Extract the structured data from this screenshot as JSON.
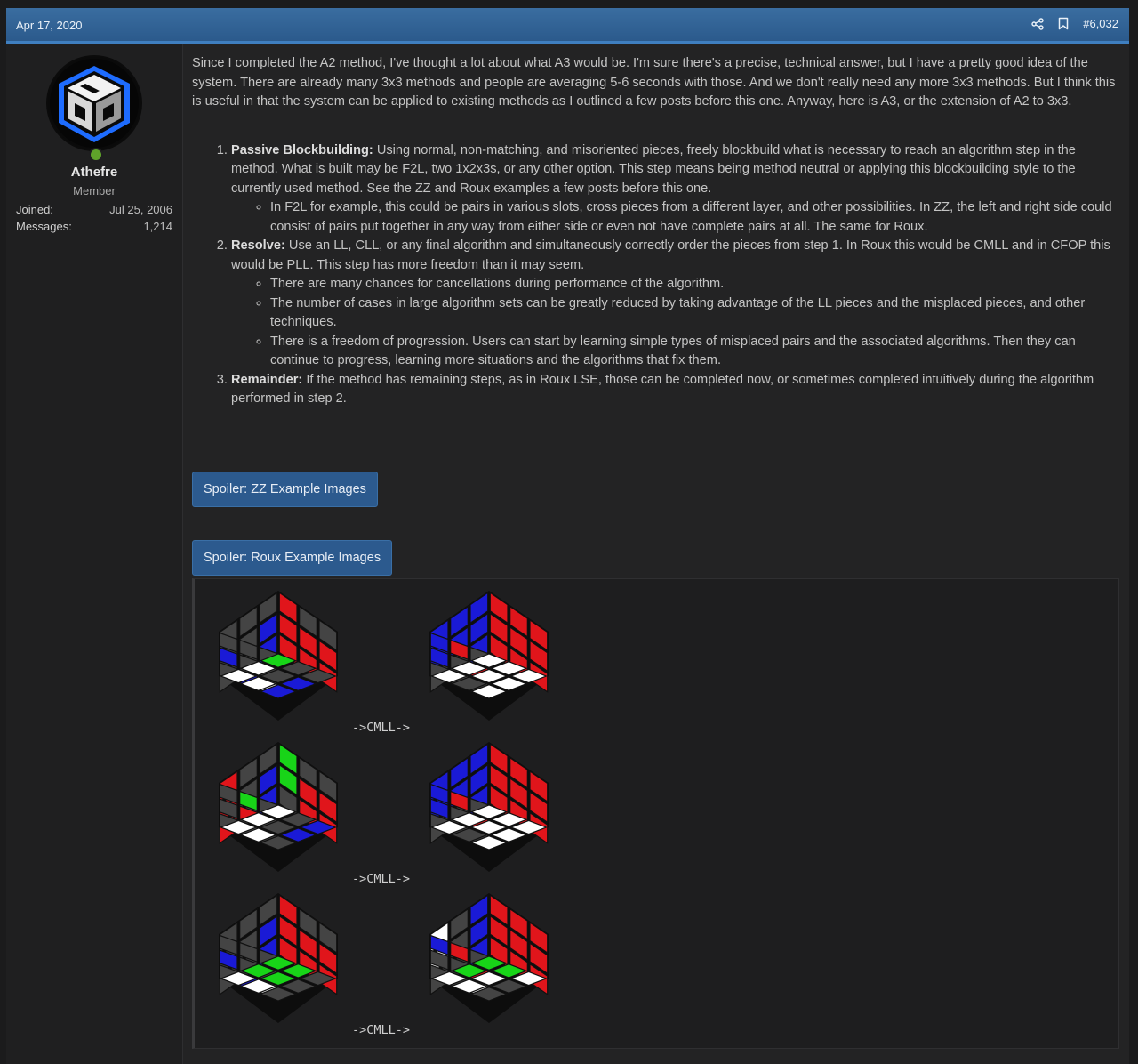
{
  "header": {
    "date": "Apr 17, 2020",
    "share_icon": "share-icon",
    "bookmark_icon": "bookmark-icon",
    "post_number": "#6,032",
    "color": "#2f5f92"
  },
  "user": {
    "name": "Athefre",
    "title": "Member",
    "online": true,
    "joined_label": "Joined:",
    "joined_value": "Jul 25, 2006",
    "messages_label": "Messages:",
    "messages_value": "1,214"
  },
  "post": {
    "intro": "Since I completed the A2 method, I've thought a lot about what A3 would be. I'm sure there's a precise, technical answer, but I have a pretty good idea of the system. There are already many 3x3 methods and people are averaging 5-6 seconds with those. And we don't really need any more 3x3 methods. But I think this is useful in that the system can be applied to existing methods as I outlined a few posts before this one. Anyway, here is A3, or the extension of A2 to 3x3.",
    "steps": [
      {
        "title": "Passive Blockbuilding:",
        "text": " Using normal, non-matching, and misoriented pieces, freely blockbuild what is necessary to reach an algorithm step in the method. What is built may be F2L, two 1x2x3s, or any other option. This step means being method neutral or applying this blockbuilding style to the currently used method. See the ZZ and Roux examples a few posts before this one.",
        "sub": [
          "In F2L for example, this could be pairs in various slots, cross pieces from a different layer, and other possibilities. In ZZ, the left and right side could consist of pairs put together in any way from either side or even not have complete pairs at all. The same for Roux."
        ]
      },
      {
        "title": "Resolve:",
        "text": " Use an LL, CLL, or any final algorithm and simultaneously correctly order the pieces from step 1. In Roux this would be CMLL and in CFOP this would be PLL. This step has more freedom than it may seem.",
        "sub": [
          "There are many chances for cancellations during performance of the algorithm.",
          "The number of cases in large algorithm sets can be greatly reduced by taking advantage of the LL pieces and the misplaced pieces, and other techniques.",
          "There is a freedom of progression. Users can start by learning simple types of misplaced pairs and the associated algorithms. Then they can continue to progress, learning more situations and the algorithms that fix them."
        ]
      },
      {
        "title": "Remainder:",
        "text": " If the method has remaining steps, as in Roux LSE, those can be completed now, or sometimes completed intuitively during the algorithm performed in step 2.",
        "sub": []
      }
    ]
  },
  "spoilers": [
    {
      "label": "Spoiler: ZZ Example Images"
    },
    {
      "label": "Spoiler: Roux Example Images"
    }
  ],
  "examples": {
    "arrow_label": "->CMLL->",
    "colors": {
      "W": "#ffffff",
      "R": "#e0151b",
      "B": "#1a1ad6",
      "G": "#18d418",
      "K": "#444444"
    },
    "rows": [
      {
        "before": {
          "top": [
            "K",
            "K",
            "K",
            "B",
            "K",
            "K",
            "K",
            "B",
            "W"
          ],
          "left": [
            "K",
            "K",
            "K",
            "B",
            "K",
            "K",
            "B",
            "K",
            "K"
          ],
          "right": [
            "R",
            "K",
            "K",
            "R",
            "R",
            "R",
            "R",
            "R",
            "R"
          ],
          "bottom": [
            "G",
            "K",
            "K",
            "W",
            "K",
            "B",
            "W",
            "W",
            "B"
          ]
        },
        "after": {
          "top": [
            "B",
            "R",
            "K",
            "B",
            "K",
            "R",
            "K",
            "K",
            "K"
          ],
          "left": [
            "B",
            "B",
            "B",
            "B",
            "B",
            "B",
            "B",
            "K",
            "K"
          ],
          "right": [
            "R",
            "R",
            "R",
            "R",
            "R",
            "R",
            "R",
            "R",
            "R"
          ],
          "bottom": [
            "W",
            "W",
            "W",
            "W",
            "W",
            "W",
            "W",
            "K",
            "W"
          ]
        }
      },
      {
        "before": {
          "top": [
            "K",
            "G",
            "K",
            "K",
            "R",
            "K",
            "K",
            "K",
            "K"
          ],
          "left": [
            "K",
            "K",
            "R",
            "B",
            "K",
            "R",
            "B",
            "K",
            "R"
          ],
          "right": [
            "G",
            "K",
            "K",
            "G",
            "R",
            "R",
            "K",
            "R",
            "R"
          ],
          "bottom": [
            "W",
            "K",
            "B",
            "W",
            "K",
            "B",
            "W",
            "W",
            "K"
          ]
        },
        "after": {
          "top": [
            "B",
            "R",
            "K",
            "B",
            "K",
            "R",
            "K",
            "K",
            "K"
          ],
          "left": [
            "B",
            "B",
            "B",
            "B",
            "B",
            "B",
            "B",
            "K",
            "K"
          ],
          "right": [
            "R",
            "R",
            "R",
            "R",
            "R",
            "R",
            "R",
            "R",
            "R"
          ],
          "bottom": [
            "W",
            "W",
            "W",
            "W",
            "W",
            "W",
            "W",
            "K",
            "W"
          ]
        }
      },
      {
        "before": {
          "top": [
            "K",
            "K",
            "K",
            "B",
            "K",
            "K",
            "K",
            "B",
            "W"
          ],
          "left": [
            "K",
            "K",
            "K",
            "B",
            "K",
            "K",
            "B",
            "K",
            "K"
          ],
          "right": [
            "R",
            "K",
            "K",
            "R",
            "R",
            "R",
            "R",
            "R",
            "R"
          ],
          "bottom": [
            "G",
            "G",
            "K",
            "G",
            "G",
            "K",
            "W",
            "W",
            "K"
          ]
        },
        "after": {
          "top": [
            "B",
            "R",
            "K",
            "K",
            "K",
            "R",
            "K",
            "K",
            "W"
          ],
          "left": [
            "B",
            "K",
            "W",
            "B",
            "K",
            "W",
            "B",
            "K",
            "K"
          ],
          "right": [
            "R",
            "R",
            "R",
            "R",
            "R",
            "R",
            "R",
            "R",
            "R"
          ],
          "bottom": [
            "G",
            "G",
            "W",
            "G",
            "W",
            "K",
            "W",
            "W",
            "K"
          ]
        }
      }
    ]
  }
}
